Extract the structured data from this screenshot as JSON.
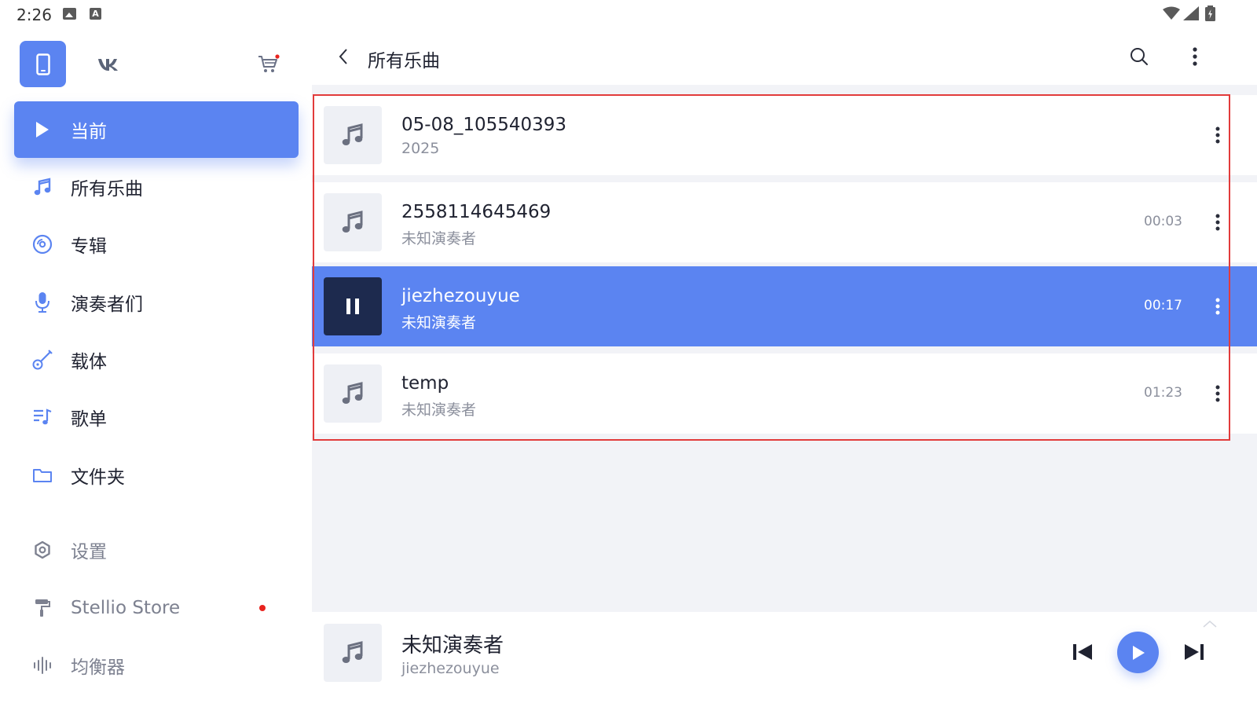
{
  "status_bar": {
    "time": "2:26",
    "icons": [
      "image-icon",
      "a-icon",
      "wifi-icon",
      "signal-icon",
      "battery-icon"
    ]
  },
  "sidebar": {
    "source_buttons": [
      {
        "name": "phone-source",
        "icon": "phone-icon",
        "active": true
      },
      {
        "name": "vk-source",
        "icon": "vk-icon"
      },
      {
        "name": "store-cart",
        "icon": "cart-icon"
      }
    ],
    "items": [
      {
        "label": "当前",
        "icon": "play-icon",
        "active": true
      },
      {
        "label": "所有乐曲",
        "icon": "music-note-icon"
      },
      {
        "label": "专辑",
        "icon": "disc-icon"
      },
      {
        "label": "演奏者们",
        "icon": "microphone-icon"
      },
      {
        "label": "载体",
        "icon": "guitar-icon"
      },
      {
        "label": "歌单",
        "icon": "playlist-icon"
      },
      {
        "label": "文件夹",
        "icon": "folder-icon"
      },
      {
        "label": "设置",
        "icon": "gear-icon"
      },
      {
        "label": "Stellio Store",
        "icon": "paint-roller-icon"
      },
      {
        "label": "均衡器",
        "icon": "equalizer-icon"
      }
    ]
  },
  "header": {
    "title": "所有乐曲"
  },
  "tracks": [
    {
      "title": "05-08_105540393",
      "subtitle": "2025",
      "duration": ""
    },
    {
      "title": "2558114645469",
      "subtitle": "未知演奏者",
      "duration": "00:03"
    },
    {
      "title": "jiezhezouyue",
      "subtitle": "未知演奏者",
      "duration": "00:17",
      "playing": true
    },
    {
      "title": "temp",
      "subtitle": "未知演奏者",
      "duration": "01:23"
    }
  ],
  "player": {
    "title": "未知演奏者",
    "subtitle": "jiezhezouyue"
  },
  "colors": {
    "accent": "#5b84f1",
    "playing_thumb": "#1d2a4e",
    "background": "#f2f3f7",
    "highlight": "#e23b3b",
    "badge": "#e8231e"
  }
}
